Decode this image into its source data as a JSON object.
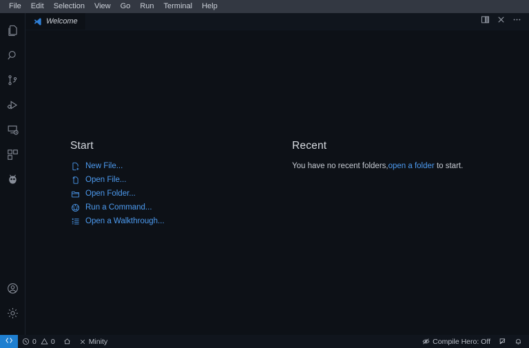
{
  "titlebar": {
    "menus": [
      {
        "label": "File",
        "name": "menu-file"
      },
      {
        "label": "Edit",
        "name": "menu-edit"
      },
      {
        "label": "Selection",
        "name": "menu-selection"
      },
      {
        "label": "View",
        "name": "menu-view"
      },
      {
        "label": "Go",
        "name": "menu-go"
      },
      {
        "label": "Run",
        "name": "menu-run"
      },
      {
        "label": "Terminal",
        "name": "menu-terminal"
      },
      {
        "label": "Help",
        "name": "menu-help"
      }
    ]
  },
  "activitybar": {
    "top": [
      {
        "icon": "explorer-icon",
        "label": "Explorer"
      },
      {
        "icon": "search-icon",
        "label": "Search"
      },
      {
        "icon": "source-control-icon",
        "label": "Source Control"
      },
      {
        "icon": "run-and-debug-icon",
        "label": "Run and Debug"
      },
      {
        "icon": "remote-explorer-icon",
        "label": "Remote Explorer"
      },
      {
        "icon": "extensions-icon",
        "label": "Extensions"
      },
      {
        "icon": "bug-icon",
        "label": "Testing"
      }
    ],
    "bottom": [
      {
        "icon": "account-icon",
        "label": "Accounts"
      },
      {
        "icon": "gear-icon",
        "label": "Manage"
      }
    ]
  },
  "editor": {
    "tab": {
      "label": "Welcome",
      "icon": "vscode-logo-icon"
    },
    "actions": [
      {
        "icon": "split-editor-icon",
        "label": "Split Editor"
      },
      {
        "icon": "close-icon",
        "label": "Close"
      },
      {
        "icon": "more-actions-icon",
        "label": "More Actions..."
      }
    ]
  },
  "welcome": {
    "start": {
      "title": "Start",
      "items": [
        {
          "label": "New File...",
          "icon": "new-file-icon"
        },
        {
          "label": "Open File...",
          "icon": "open-file-icon"
        },
        {
          "label": "Open Folder...",
          "icon": "folder-icon"
        },
        {
          "label": "Run a Command...",
          "icon": "command-icon"
        },
        {
          "label": "Open a Walkthrough...",
          "icon": "walkthrough-icon"
        }
      ]
    },
    "recent": {
      "title": "Recent",
      "empty_prefix": "You have no recent folders,",
      "empty_link": "open a folder",
      "empty_suffix": "to start."
    }
  },
  "statusbar": {
    "remote": {
      "icon": "remote-window-icon",
      "label": ""
    },
    "left": [
      {
        "name": "problems",
        "icon": "error-warning-icon",
        "errors": "0",
        "warnings": "0"
      },
      {
        "name": "home",
        "icon": "home-icon",
        "label": ""
      },
      {
        "name": "minify",
        "icon": "close-icon",
        "label": "Minity"
      }
    ],
    "right": [
      {
        "name": "compile-hero",
        "icon": "compile-hero-icon",
        "label": "Compile Hero: Off"
      },
      {
        "name": "feedback",
        "icon": "feedback-icon",
        "label": ""
      },
      {
        "name": "notifications",
        "icon": "bell-icon",
        "label": ""
      }
    ]
  },
  "colors": {
    "titlebar_bg": "#333842",
    "editor_bg": "#0d1117",
    "accent_link": "#4d9bf0",
    "remote_bg": "#1f7fd0"
  }
}
